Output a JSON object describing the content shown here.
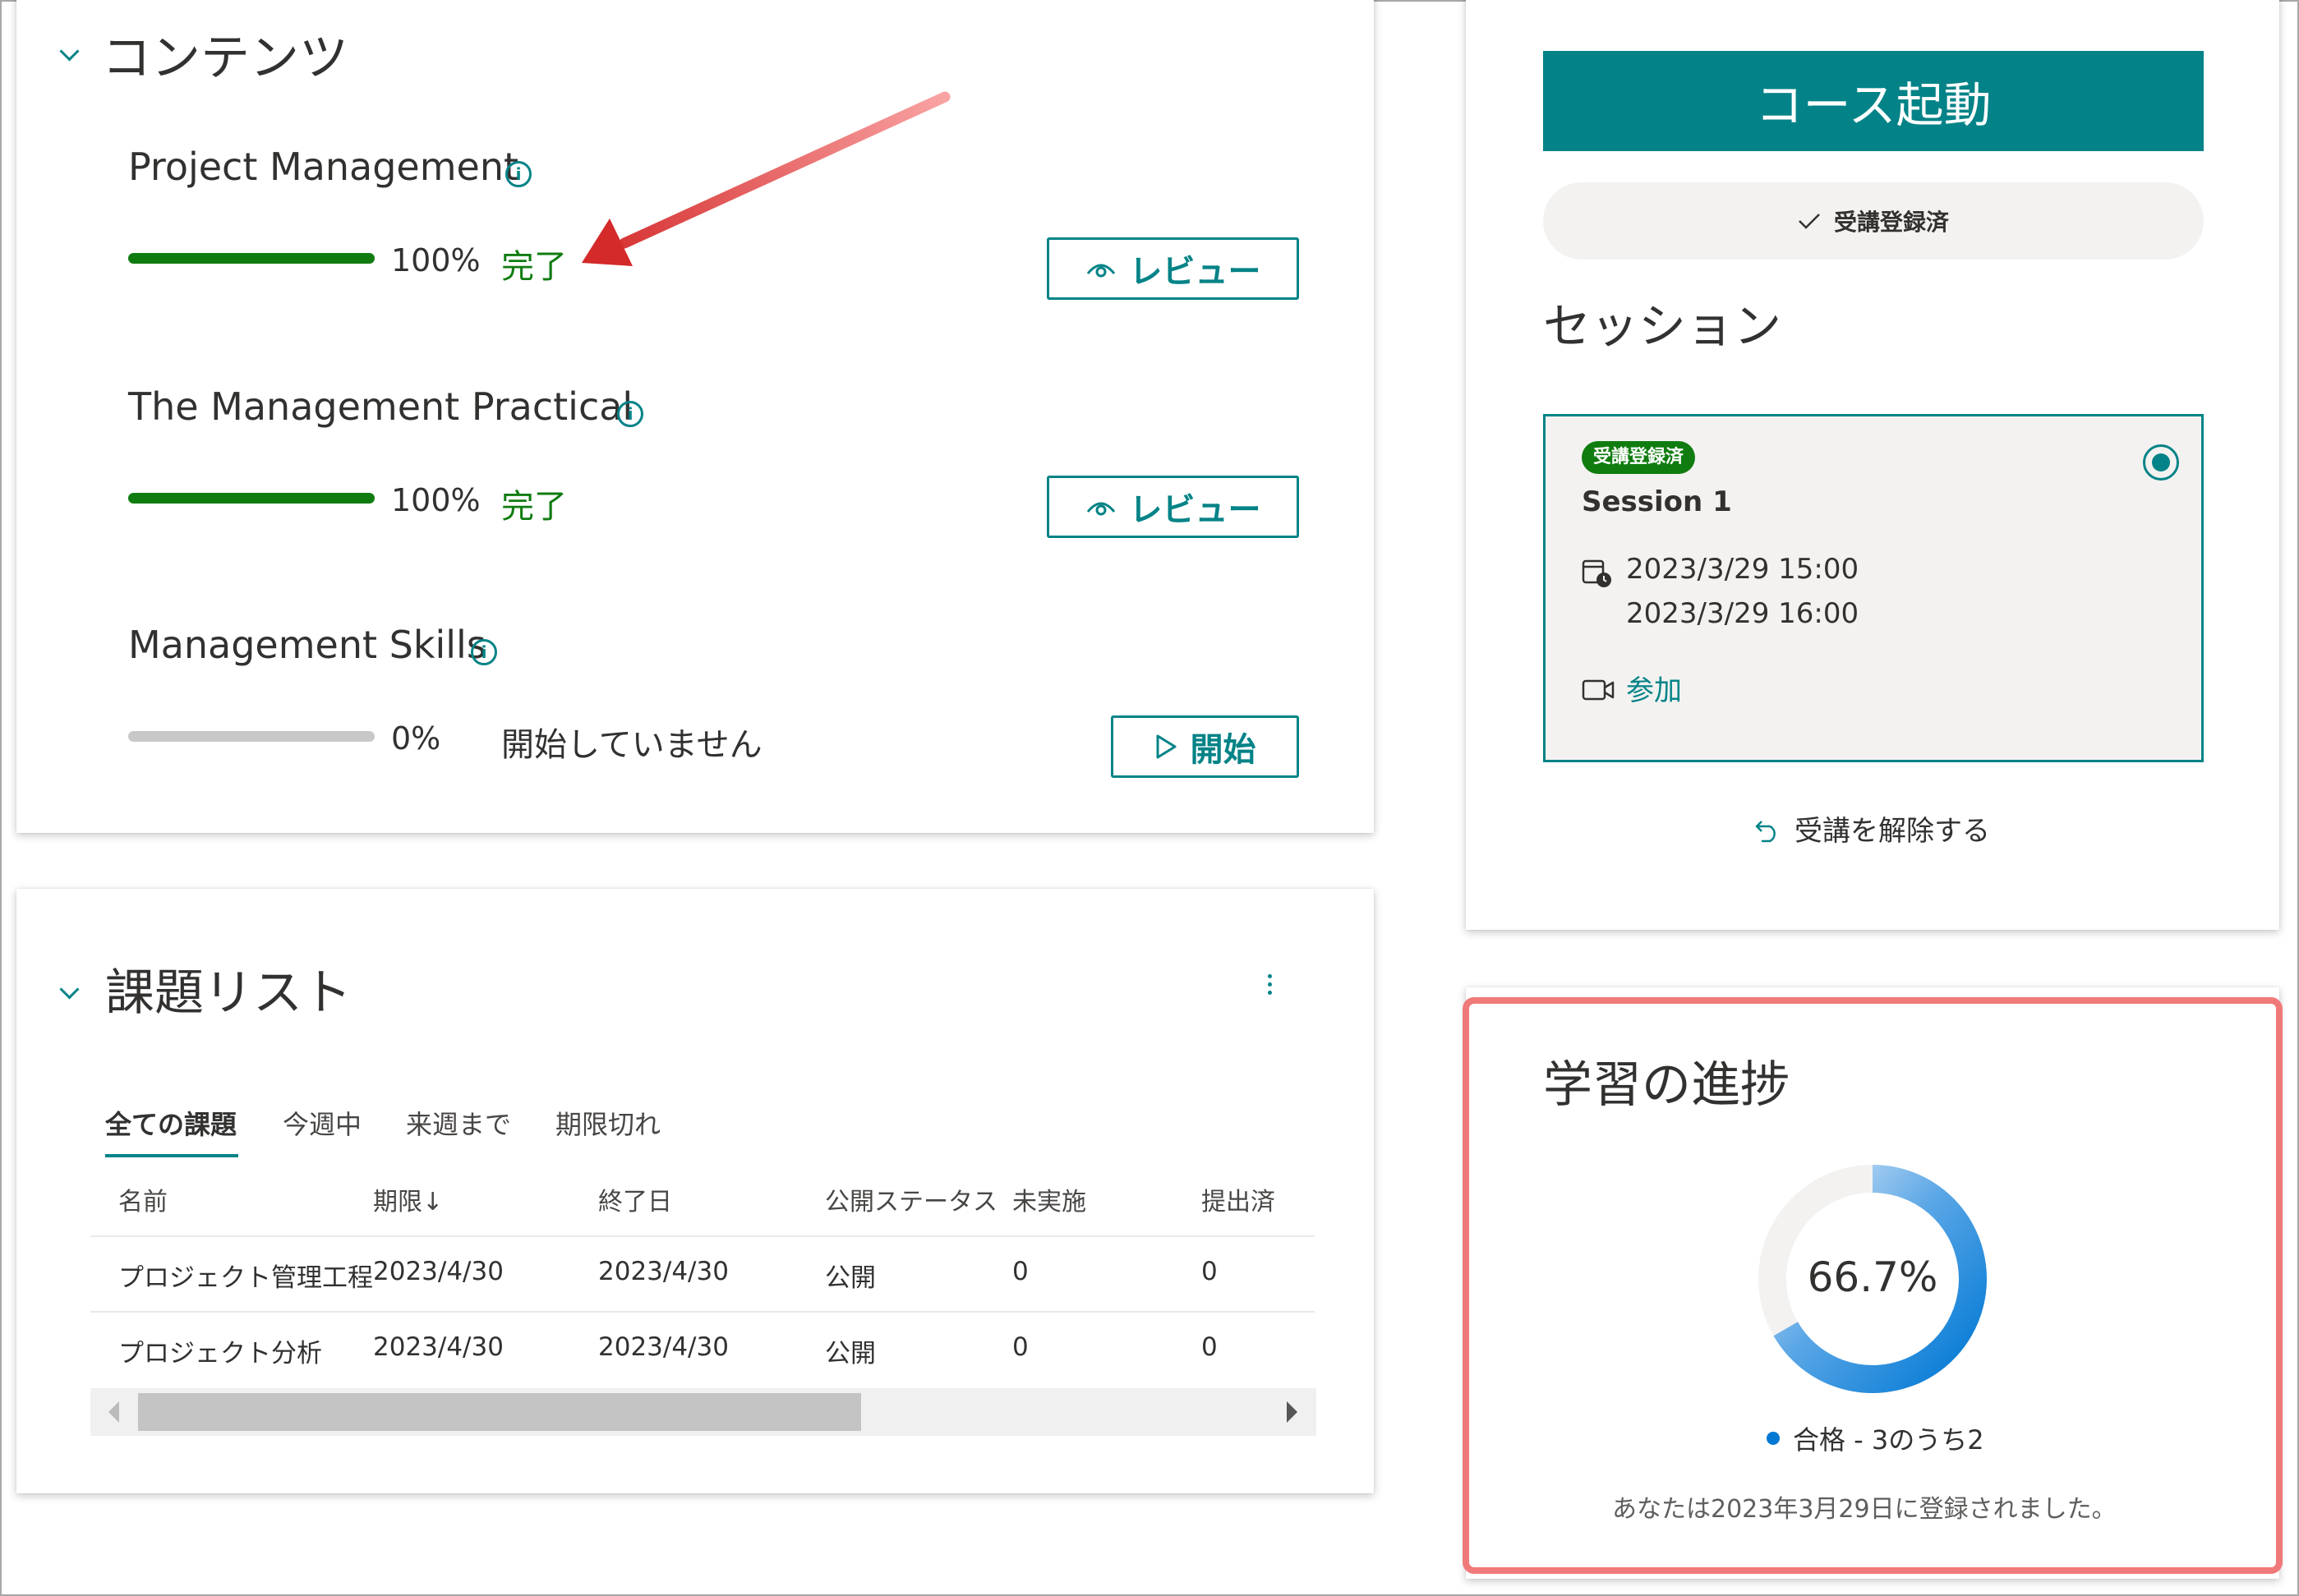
{
  "contents": {
    "title": "コンテンツ",
    "items": [
      {
        "name": "Project Management",
        "percent": "100%",
        "progress": 1.0,
        "status": "完了",
        "button_label": "レビュー"
      },
      {
        "name": "The Management Practical",
        "percent": "100%",
        "progress": 1.0,
        "status": "完了",
        "button_label": "レビュー"
      },
      {
        "name": "Management Skills",
        "percent": "0%",
        "progress": 0.0,
        "status": "開始していません",
        "button_label": "開始"
      }
    ]
  },
  "tasks": {
    "title": "課題リスト",
    "tabs": [
      "全ての課題",
      "今週中",
      "来週まで",
      "期限切れ"
    ],
    "columns": [
      "名前",
      "期限↓",
      "終了日",
      "公開ステータス",
      "未実施",
      "提出済"
    ],
    "rows": [
      [
        "プロジェクト管理工程",
        "2023/4/30",
        "2023/4/30",
        "公開",
        "0",
        "0"
      ],
      [
        "プロジェクト分析",
        "2023/4/30",
        "2023/4/30",
        "公開",
        "0",
        "0"
      ]
    ]
  },
  "course": {
    "launch_label": "コース起動",
    "enrolled_label": "受講登録済",
    "sessions_title": "セッション",
    "session": {
      "badge": "受講登録済",
      "name": "Session 1",
      "start": "2023/3/29 15:00",
      "end": "2023/3/29 16:00",
      "join_label": "参加"
    },
    "unenroll_label": "受講を解除する"
  },
  "progress_card": {
    "title": "学習の進捗",
    "percent_text": "66.7%",
    "fraction": 0.667,
    "legend": "合格 - 3のうち2",
    "enrolled_note": "あなたは2023年3月29日に登録されました。"
  },
  "colors": {
    "accent": "#038387",
    "complete": "#107c10",
    "progress_blue": "#0078d4",
    "highlight": "#f07a7a",
    "arrow": "#d42a2a"
  }
}
